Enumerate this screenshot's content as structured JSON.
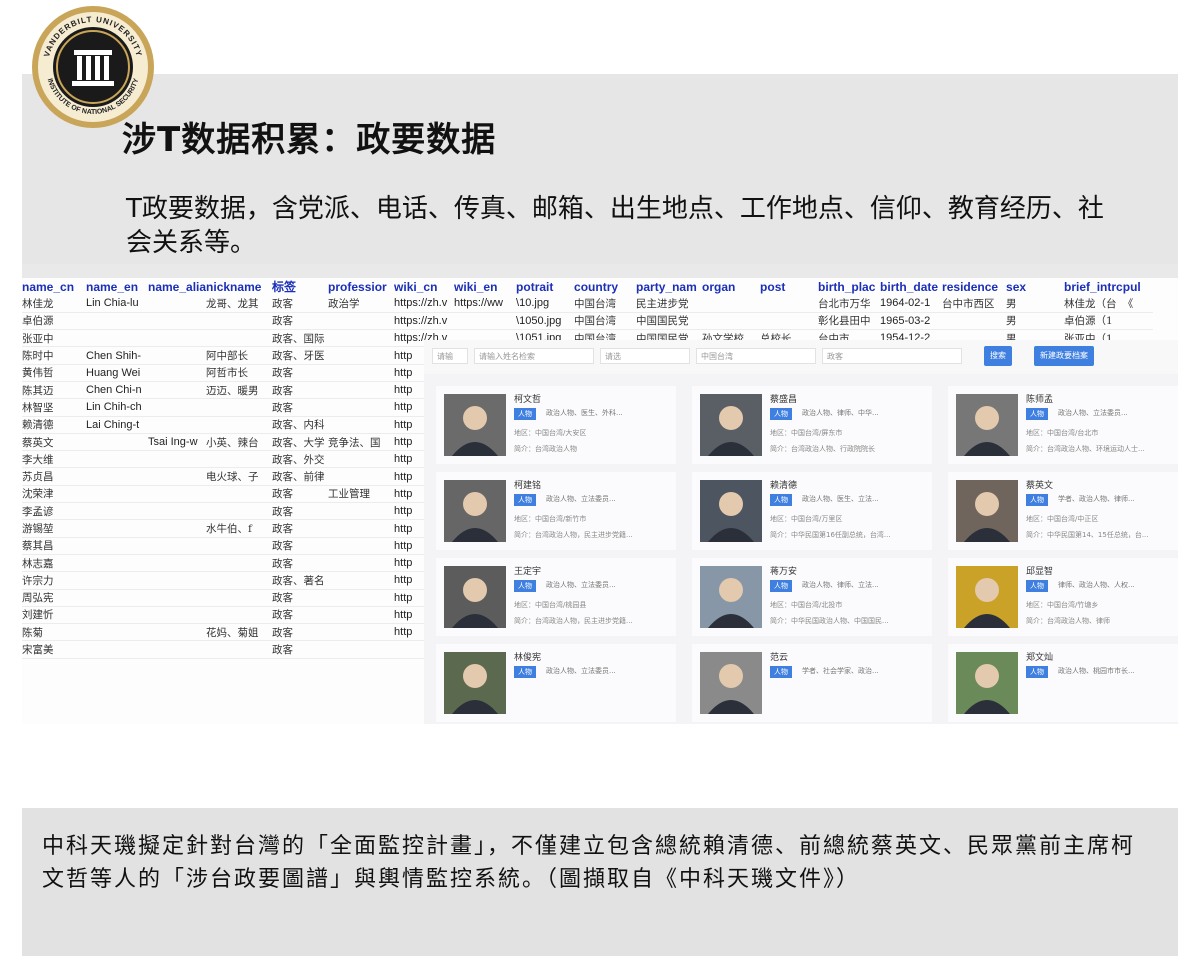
{
  "seal": {
    "arc_text": "VANDERBILT UNIVERSITY",
    "bottom_text": "INSTITUTE OF NATIONAL SECURITY"
  },
  "slide": {
    "title": "涉T数据积累：政要数据",
    "subtitle": "T政要数据，含党派、电话、传真、邮箱、出生地点、工作地点、信仰、教育经历、社会关系等。"
  },
  "sheet": {
    "headers": [
      "name_cn",
      "name_en",
      "name_alia",
      "nickname",
      "标签",
      "professior",
      "wiki_cn",
      "wiki_en",
      "potrait",
      "country",
      "party_nam",
      "organ",
      "post",
      "birth_plac",
      "birth_date",
      "residence",
      "sex",
      "brief_intrc",
      "pul"
    ],
    "rows": [
      [
        "林佳龙",
        "Lin Chia-lu",
        "",
        "龙哥、龙其",
        "政客",
        "政治学",
        "https://zh.v",
        "https://ww",
        "\\10.jpg",
        "中国台湾",
        "民主进步党",
        "",
        "",
        "台北市万华",
        "1964-02-1",
        "台中市西区",
        "男",
        "林佳龙（台",
        "《"
      ],
      [
        "卓伯源",
        "",
        "",
        "",
        "政客",
        "",
        "https://zh.v",
        "",
        "\\1050.jpg",
        "中国台湾",
        "中国国民党",
        "",
        "",
        "彰化县田中",
        "1965-03-2",
        "",
        "男",
        "卓伯源（1",
        ""
      ],
      [
        "张亚中",
        "",
        "",
        "",
        "政客、国际",
        "",
        "https://zh.v",
        "",
        "\\1051.jpg",
        "中国台湾",
        "中国国民党",
        "孙文学校",
        "总校长",
        "台中市",
        "1954-12-2",
        "",
        "男",
        "张亚中（1",
        ""
      ],
      [
        "陈时中",
        "Chen Shih-",
        "",
        "阿中部长",
        "政客、牙医",
        "",
        "http",
        "",
        "",
        "",
        "",
        "",
        "",
        "",
        "",
        "",
        "",
        "",
        ""
      ],
      [
        "黄伟哲",
        "Huang Wei",
        "",
        "阿哲市长",
        "政客",
        "",
        "http",
        "",
        "",
        "",
        "",
        "",
        "",
        "",
        "",
        "",
        "",
        "",
        ""
      ],
      [
        "陈其迈",
        "Chen Chi-n",
        "",
        "迈迈、暖男",
        "政客",
        "",
        "http",
        "",
        "",
        "",
        "",
        "",
        "",
        "",
        "",
        "",
        "",
        "",
        ""
      ],
      [
        "林智坚",
        "Lin Chih-ch",
        "",
        "",
        "政客",
        "",
        "http",
        "",
        "",
        "",
        "",
        "",
        "",
        "",
        "",
        "",
        "",
        "",
        ""
      ],
      [
        "赖清德",
        "Lai Ching-t",
        "",
        "",
        "政客、内科",
        "",
        "http",
        "",
        "",
        "",
        "",
        "",
        "",
        "",
        "",
        "",
        "",
        "",
        ""
      ],
      [
        "蔡英文",
        "",
        "Tsai Ing-w",
        "小英、辣台",
        "政客、大学",
        "竞争法、国",
        "http",
        "",
        "",
        "",
        "",
        "",
        "",
        "",
        "",
        "",
        "",
        "",
        ""
      ],
      [
        "李大维",
        "",
        "",
        "",
        "政客、外交",
        "",
        "http",
        "",
        "",
        "",
        "",
        "",
        "",
        "",
        "",
        "",
        "",
        "",
        ""
      ],
      [
        "苏贞昌",
        "",
        "",
        "电火球、子",
        "政客、前律",
        "",
        "http",
        "",
        "",
        "",
        "",
        "",
        "",
        "",
        "",
        "",
        "",
        "",
        ""
      ],
      [
        "沈荣津",
        "",
        "",
        "",
        "政客",
        "工业管理",
        "http",
        "",
        "",
        "",
        "",
        "",
        "",
        "",
        "",
        "",
        "",
        "",
        ""
      ],
      [
        "李孟谚",
        "",
        "",
        "",
        "政客",
        "",
        "http",
        "",
        "",
        "",
        "",
        "",
        "",
        "",
        "",
        "",
        "",
        "",
        ""
      ],
      [
        "游锡堃",
        "",
        "",
        "水牛伯、f",
        "政客",
        "",
        "http",
        "",
        "",
        "",
        "",
        "",
        "",
        "",
        "",
        "",
        "",
        "",
        ""
      ],
      [
        "蔡其昌",
        "",
        "",
        "",
        "政客",
        "",
        "http",
        "",
        "",
        "",
        "",
        "",
        "",
        "",
        "",
        "",
        "",
        "",
        ""
      ],
      [
        "林志嘉",
        "",
        "",
        "",
        "政客",
        "",
        "http",
        "",
        "",
        "",
        "",
        "",
        "",
        "",
        "",
        "",
        "",
        "",
        ""
      ],
      [
        "许宗力",
        "",
        "",
        "",
        "政客、著名",
        "",
        "http",
        "",
        "",
        "",
        "",
        "",
        "",
        "",
        "",
        "",
        "",
        "",
        ""
      ],
      [
        "周弘宪",
        "",
        "",
        "",
        "政客",
        "",
        "http",
        "",
        "",
        "",
        "",
        "",
        "",
        "",
        "",
        "",
        "",
        "",
        ""
      ],
      [
        "刘建忻",
        "",
        "",
        "",
        "政客",
        "",
        "http",
        "",
        "",
        "",
        "",
        "",
        "",
        "",
        "",
        "",
        "",
        "",
        ""
      ],
      [
        "陈菊",
        "",
        "",
        "花妈、菊姐",
        "政客",
        "",
        "http",
        "",
        "",
        "",
        "",
        "",
        "",
        "",
        "",
        "",
        "",
        "",
        ""
      ],
      [
        "宋富美",
        "",
        "",
        "",
        "政客",
        "",
        "",
        "",
        "",
        "",
        "",
        "",
        "",
        "",
        "",
        "",
        "",
        "",
        ""
      ]
    ]
  },
  "panel": {
    "filters": [
      "请输",
      "请输入姓名检索",
      "请选",
      "中国台湾",
      "政客"
    ],
    "buttons": [
      "搜索",
      "新建政要档案"
    ],
    "cards": [
      {
        "name": "柯文哲",
        "tag": "人物",
        "desc": "政治人物、医生、外科...",
        "l2": "地区：中国台湾/大安区",
        "l3": "简介：台湾政治人物"
      },
      {
        "name": "蔡盛昌",
        "tag": "人物",
        "desc": "政治人物、律师、中华...",
        "l2": "地区：中国台湾/屏东市",
        "l3": "简介：台湾政治人物、行政院院长"
      },
      {
        "name": "陈师孟",
        "tag": "人物",
        "desc": "政治人物、立法委员...",
        "l2": "地区：中国台湾/台北市",
        "l3": "简介：台湾政治人物、环境运动人士..."
      },
      {
        "name": "柯建铭",
        "tag": "人物",
        "desc": "政治人物、立法委员...",
        "l2": "地区：中国台湾/新竹市",
        "l3": "简介：台湾政治人物，民主进步党籍..."
      },
      {
        "name": "赖清德",
        "tag": "人物",
        "desc": "政治人物、医生、立法...",
        "l2": "地区：中国台湾/万里区",
        "l3": "简介：中华民国第16任副总统，台湾..."
      },
      {
        "name": "蔡英文",
        "tag": "人物",
        "desc": "学者、政治人物、律师...",
        "l2": "地区：中国台湾/中正区",
        "l3": "简介：中华民国第14、15任总统，台..."
      },
      {
        "name": "王定宇",
        "tag": "人物",
        "desc": "政治人物、立法委员...",
        "l2": "地区：中国台湾/桃园县",
        "l3": "简介：台湾政治人物，民主进步党籍..."
      },
      {
        "name": "蒋万安",
        "tag": "人物",
        "desc": "政治人物、律师、立法...",
        "l2": "地区：中国台湾/北投市",
        "l3": "简介：中华民国政治人物、中国国民..."
      },
      {
        "name": "邱显智",
        "tag": "人物",
        "desc": "律师、政治人物、人权...",
        "l2": "地区：中国台湾/竹塘乡",
        "l3": "简介：台湾政治人物、律师"
      },
      {
        "name": "林俊宪",
        "tag": "人物",
        "desc": "政治人物、立法委员...",
        "l2": "",
        "l3": ""
      },
      {
        "name": "范云",
        "tag": "人物",
        "desc": "学者、社会学家、政治...",
        "l2": "",
        "l3": ""
      },
      {
        "name": "郑文灿",
        "tag": "人物",
        "desc": "政治人物、桃园市市长...",
        "l2": "",
        "l3": ""
      }
    ]
  },
  "caption": "中科天璣擬定針對台灣的「全面監控計畫」，不僅建立包含總統賴清德、前總統蔡英文、民眾黨前主席柯文哲等人的「涉台政要圖譜」與輿情監控系統。（圖擷取自《中科天璣文件》）"
}
